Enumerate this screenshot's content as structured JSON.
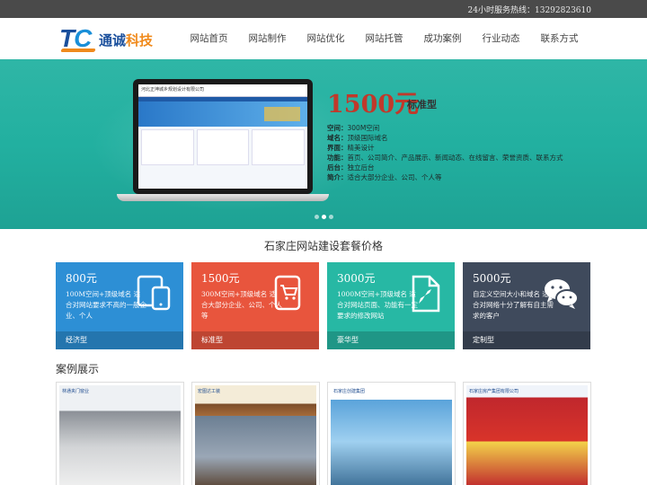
{
  "topbar": {
    "hotline": "24小时服务热线：13292823610"
  },
  "logo": {
    "tc_t": "T",
    "tc_c": "C",
    "cn_1": "通诚",
    "cn_2": "科技"
  },
  "nav": [
    "网站首页",
    "网站制作",
    "网站优化",
    "网站托管",
    "成功案例",
    "行业动态",
    "联系方式"
  ],
  "banner": {
    "price": "1500元",
    "tag": "标准型",
    "screen_title": "河北正坤城乡规划设计有限公司",
    "specs": [
      {
        "k": "空间：",
        "v": "300M空间"
      },
      {
        "k": "域名：",
        "v": "顶级国际域名"
      },
      {
        "k": "界面：",
        "v": "精美设计"
      },
      {
        "k": "功能：",
        "v": "首页、公司简介、产品展示、新闻动态、在线留言、荣誉资质、联系方式"
      },
      {
        "k": "后台：",
        "v": "独立后台"
      },
      {
        "k": "简介：",
        "v": "适合大部分企业、公司、个人等"
      }
    ],
    "slides": 3,
    "active_slide": 1
  },
  "section_title": "石家庄网站建设套餐价格",
  "packages": [
    {
      "price": "800元",
      "desc": "100M空间+顶级域名 适合对网站要求不高的一般企业、个人",
      "label": "经济型",
      "color": "#2d8fd5",
      "icon": "devices-icon"
    },
    {
      "price": "1500元",
      "desc": "300M空间+顶级域名 适合大部分企业、公司、个人等",
      "label": "标准型",
      "color": "#e8553d",
      "icon": "cart-icon"
    },
    {
      "price": "3000元",
      "desc": "1000M空间+顶级域名 适合对网站页面、功能有一定要求的修改网站",
      "label": "豪华型",
      "color": "#27b8a4",
      "icon": "rocket-icon"
    },
    {
      "price": "5000元",
      "desc": "自定义空间大小和域名 适合对网络十分了解有自主需求的客户",
      "label": "定制型",
      "color": "#3f4a5c",
      "icon": "wechat-icon"
    }
  ],
  "case_title": "案例展示",
  "cases": [
    {
      "caption": "林通夹门窗业"
    },
    {
      "caption": "宏图达工装"
    },
    {
      "caption": "石家庄创建集团"
    },
    {
      "caption": "石家庄房产集团有限公司"
    }
  ]
}
